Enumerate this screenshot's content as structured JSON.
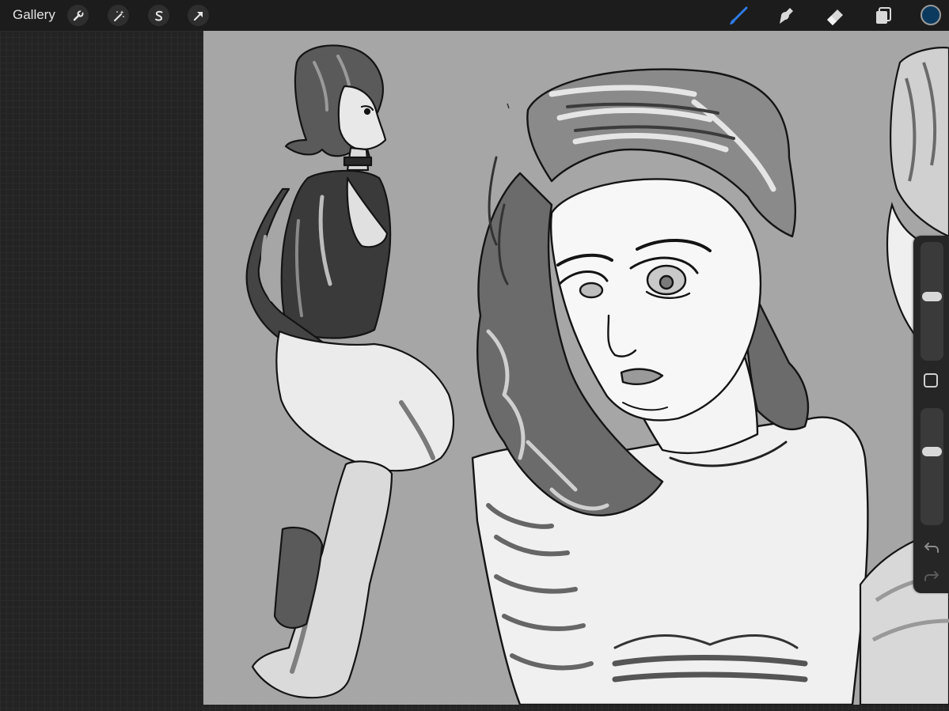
{
  "toolbar": {
    "gallery_label": "Gallery",
    "left_tools": [
      "wrench-icon",
      "magic-wand-icon",
      "selection-s-icon",
      "arrow-transform-icon"
    ],
    "right_tools": [
      "brush-icon",
      "smudge-icon",
      "eraser-icon",
      "layers-icon"
    ],
    "active_tool": "brush-icon",
    "active_tool_color": "#2f7be8",
    "current_color": "#0b3a5e"
  },
  "sidebar": {
    "brush_size_level": 0.55,
    "brush_opacity_level": 0.65,
    "icons": [
      "modify-square-icon",
      "undo-icon",
      "redo-icon"
    ]
  },
  "canvas": {
    "background": "#a6a6a6",
    "content": "grayscale-figure-sketches"
  }
}
